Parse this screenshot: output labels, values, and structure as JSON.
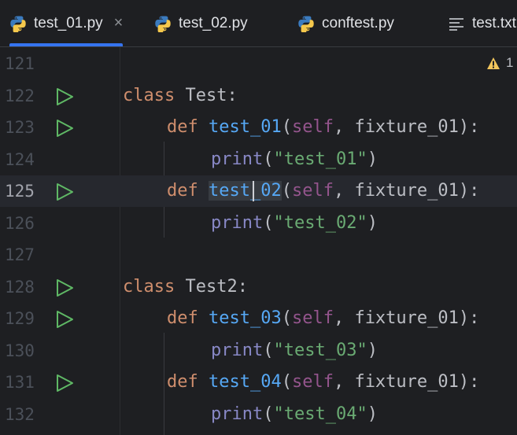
{
  "tabs": [
    {
      "label": "test_01.py",
      "icon": "python-icon",
      "active": true,
      "close": "×"
    },
    {
      "label": "test_02.py",
      "icon": "python-icon",
      "active": false
    },
    {
      "label": "conftest.py",
      "icon": "python-icon",
      "active": false
    },
    {
      "label": "test.txt",
      "icon": "text-file-icon",
      "active": false
    }
  ],
  "inspections": {
    "warning_count": "1",
    "icon": "warning-triangle-icon",
    "color": "#f2c55c"
  },
  "editor": {
    "current_line": "125",
    "lines": [
      {
        "number": "121",
        "run": false,
        "tokens": []
      },
      {
        "number": "122",
        "run": true,
        "tokens": [
          {
            "t": "class",
            "c": "kw"
          },
          {
            "t": " Test:",
            "c": ""
          }
        ]
      },
      {
        "number": "123",
        "run": true,
        "tokens": [
          {
            "t": "def",
            "c": "kw"
          },
          {
            "t": " ",
            "c": ""
          },
          {
            "t": "test_01",
            "c": "fn"
          },
          {
            "t": "(",
            "c": ""
          },
          {
            "t": "self",
            "c": "slf"
          },
          {
            "t": ", fixture_01):",
            "c": ""
          }
        ]
      },
      {
        "number": "124",
        "run": false,
        "tokens": [
          {
            "t": "print",
            "c": "bi"
          },
          {
            "t": "(",
            "c": ""
          },
          {
            "t": "\"test_01\"",
            "c": "str"
          },
          {
            "t": ")",
            "c": ""
          }
        ]
      },
      {
        "number": "125",
        "run": true,
        "tokens": [
          {
            "t": "def",
            "c": "kw"
          },
          {
            "t": " ",
            "c": ""
          },
          {
            "t": "test_02",
            "c": "fn"
          },
          {
            "t": "(",
            "c": ""
          },
          {
            "t": "self",
            "c": "slf"
          },
          {
            "t": ", fixture_01):",
            "c": ""
          }
        ]
      },
      {
        "number": "126",
        "run": false,
        "tokens": [
          {
            "t": "print",
            "c": "bi"
          },
          {
            "t": "(",
            "c": ""
          },
          {
            "t": "\"test_02\"",
            "c": "str"
          },
          {
            "t": ")",
            "c": ""
          }
        ]
      },
      {
        "number": "127",
        "run": false,
        "tokens": []
      },
      {
        "number": "128",
        "run": true,
        "tokens": [
          {
            "t": "class",
            "c": "kw"
          },
          {
            "t": " Test2:",
            "c": ""
          }
        ]
      },
      {
        "number": "129",
        "run": true,
        "tokens": [
          {
            "t": "def",
            "c": "kw"
          },
          {
            "t": " ",
            "c": ""
          },
          {
            "t": "test_03",
            "c": "fn"
          },
          {
            "t": "(",
            "c": ""
          },
          {
            "t": "self",
            "c": "slf"
          },
          {
            "t": ", fixture_01):",
            "c": ""
          }
        ]
      },
      {
        "number": "130",
        "run": false,
        "tokens": [
          {
            "t": "print",
            "c": "bi"
          },
          {
            "t": "(",
            "c": ""
          },
          {
            "t": "\"test_03\"",
            "c": "str"
          },
          {
            "t": ")",
            "c": ""
          }
        ]
      },
      {
        "number": "131",
        "run": true,
        "tokens": [
          {
            "t": "def",
            "c": "kw"
          },
          {
            "t": " ",
            "c": ""
          },
          {
            "t": "test_04",
            "c": "fn"
          },
          {
            "t": "(",
            "c": ""
          },
          {
            "t": "self",
            "c": "slf"
          },
          {
            "t": ", fixture_01):",
            "c": ""
          }
        ]
      },
      {
        "number": "132",
        "run": false,
        "tokens": [
          {
            "t": "print",
            "c": "bi"
          },
          {
            "t": "(",
            "c": ""
          },
          {
            "t": "\"test_04\"",
            "c": "str"
          },
          {
            "t": ")",
            "c": ""
          }
        ]
      }
    ]
  },
  "colors": {
    "background": "#1e1f22",
    "keyword": "#cf8e6d",
    "function": "#56a8f5",
    "self": "#94558d",
    "builtin": "#8888c6",
    "string": "#6aab73",
    "run_gutter": "#5fb865",
    "active_tab_underline": "#3574f0"
  }
}
